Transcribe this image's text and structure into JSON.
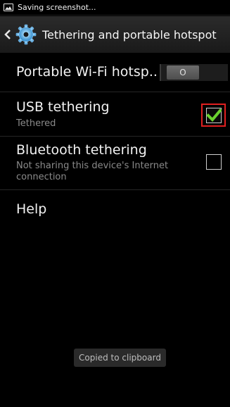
{
  "status_bar": {
    "text": "Saving screenshot...",
    "icon": "image-icon"
  },
  "action_bar": {
    "title": "Tethering and portable hotspot",
    "icon": "settings-gear-icon"
  },
  "items": [
    {
      "title": "Portable Wi-Fi hotsp..",
      "toggle_state": "O",
      "enabled": false
    },
    {
      "title": "USB tethering",
      "subtitle": "Tethered",
      "checked": true
    },
    {
      "title": "Bluetooth tethering",
      "subtitle": "Not sharing this device's Internet connection",
      "checked": false
    },
    {
      "title": "Help"
    }
  ],
  "toast": {
    "text": "Copied to clipboard"
  },
  "colors": {
    "check_green": "#6ad12f",
    "highlight_red": "#e02020",
    "background": "#000000"
  }
}
